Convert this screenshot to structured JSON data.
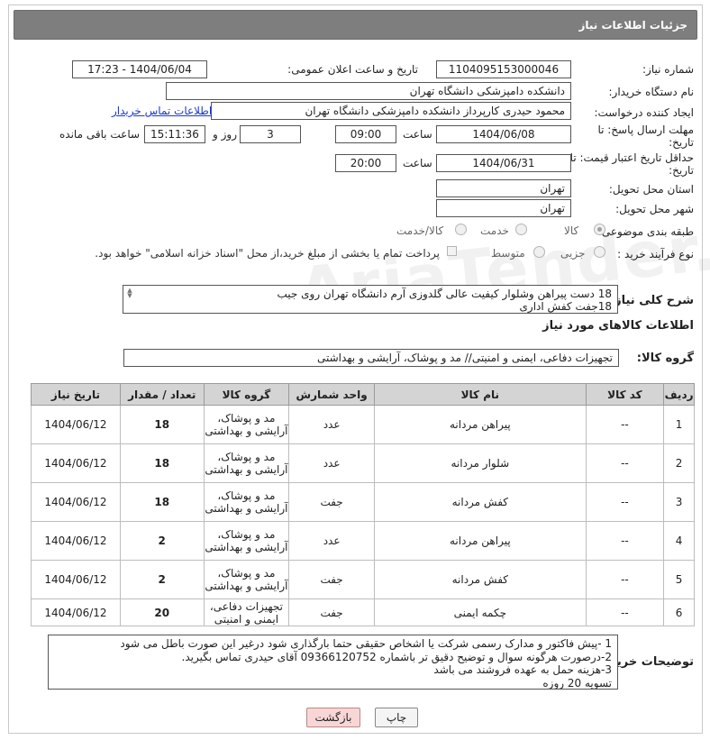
{
  "header": {
    "title": "جزئیات اطلاعات نیاز"
  },
  "form": {
    "need_number_label": "شماره نیاز:",
    "need_number": "1104095153000046",
    "announce_label": "تاریخ و ساعت اعلان عمومی:",
    "announce_value": "1404/06/04 - 17:23",
    "buyer_org_label": "نام دستگاه خریدار:",
    "buyer_org": "دانشکده دامپزشکی دانشگاه تهران",
    "creator_label": "ایجاد کننده درخواست:",
    "creator": "محمود حیدری کارپرداز دانشکده دامپزشکی دانشگاه تهران",
    "contact_link": "اطلاعات تماس خریدار",
    "deadline_label": "مهلت ارسال پاسخ: تا تاریخ:",
    "deadline_date": "1404/06/08",
    "time_label": "ساعت",
    "deadline_time": "09:00",
    "days_value": "3",
    "days_label": "روز و",
    "remaining_time": "15:11:36",
    "remaining_label": "ساعت باقی مانده",
    "min_validity_label": "حداقل تاریخ اعتبار قیمت: تا تاریخ:",
    "validity_date": "1404/06/31",
    "validity_time": "20:00",
    "province_label": "استان محل تحویل:",
    "province": "تهران",
    "city_label": "شهر محل تحویل:",
    "city": "تهران",
    "category_label": "طبقه بندی موضوعی:",
    "category_options": [
      "کالا",
      "خدمت",
      "کالا/خدمت"
    ],
    "process_label": "نوع فرآیند خرید :",
    "process_options": [
      "جزیی",
      "متوسط"
    ],
    "payment_note": "پرداخت تمام یا بخشی از مبلغ خرید،از محل \"اسناد خزانه اسلامی\" خواهد بود.",
    "summary_label": "شرح کلی نیاز:",
    "summary_lines": [
      "18 دست پیراهن وشلوار کیفیت عالی گلدوزی آرم دانشگاه تهران روی جیب",
      "18جفت کفش اداری"
    ],
    "goods_info_title": "اطلاعات کالاهای مورد نیاز",
    "goods_group_label": "گروه کالا:",
    "goods_group": "تجهیزات دفاعی، ایمنی و امنیتی// مد و پوشاک، آرایشی و بهداشتی"
  },
  "table": {
    "headers": [
      "ردیف",
      "کد کالا",
      "نام کالا",
      "واحد شمارش",
      "گروه کالا",
      "تعداد / مقدار",
      "تاریخ نیاز"
    ],
    "rows": [
      [
        "1",
        "--",
        "پیراهن مردانه",
        "عدد",
        "مد و پوشاک، آرایشی و بهداشتی",
        "18",
        "1404/06/12"
      ],
      [
        "2",
        "--",
        "شلوار مردانه",
        "عدد",
        "مد و پوشاک، آرایشی و بهداشتی",
        "18",
        "1404/06/12"
      ],
      [
        "3",
        "--",
        "کفش مردانه",
        "جفت",
        "مد و پوشاک، آرایشی و بهداشتی",
        "18",
        "1404/06/12"
      ],
      [
        "4",
        "--",
        "پیراهن مردانه",
        "عدد",
        "مد و پوشاک، آرایشی و بهداشتی",
        "2",
        "1404/06/12"
      ],
      [
        "5",
        "--",
        "کفش مردانه",
        "جفت",
        "مد و پوشاک، آرایشی و بهداشتی",
        "2",
        "1404/06/12"
      ],
      [
        "6",
        "--",
        "چکمه ایمنی",
        "جفت",
        "تجهیزات دفاعی، ایمنی و امنیتی",
        "20",
        "1404/06/12"
      ]
    ]
  },
  "notes": {
    "label": "توضیحات خریدار:",
    "lines": [
      "1 -پیش فاکتور و مدارک رسمی شرکت  یا اشخاص حقیقی حتما بارگذاری شود  درغیر این صورت باطل می شود",
      "2-درصورت هرگونه سوال و توضیح دقیق تر باشماره 09366120752 آقای حیدری تماس بگیرید.",
      "3-هزینه حمل به عهده فروشند می باشد",
      "تسویه 20 روزه"
    ]
  },
  "buttons": {
    "print": "چاپ",
    "back": "بازگشت"
  },
  "watermark": "AriaTender.neT"
}
